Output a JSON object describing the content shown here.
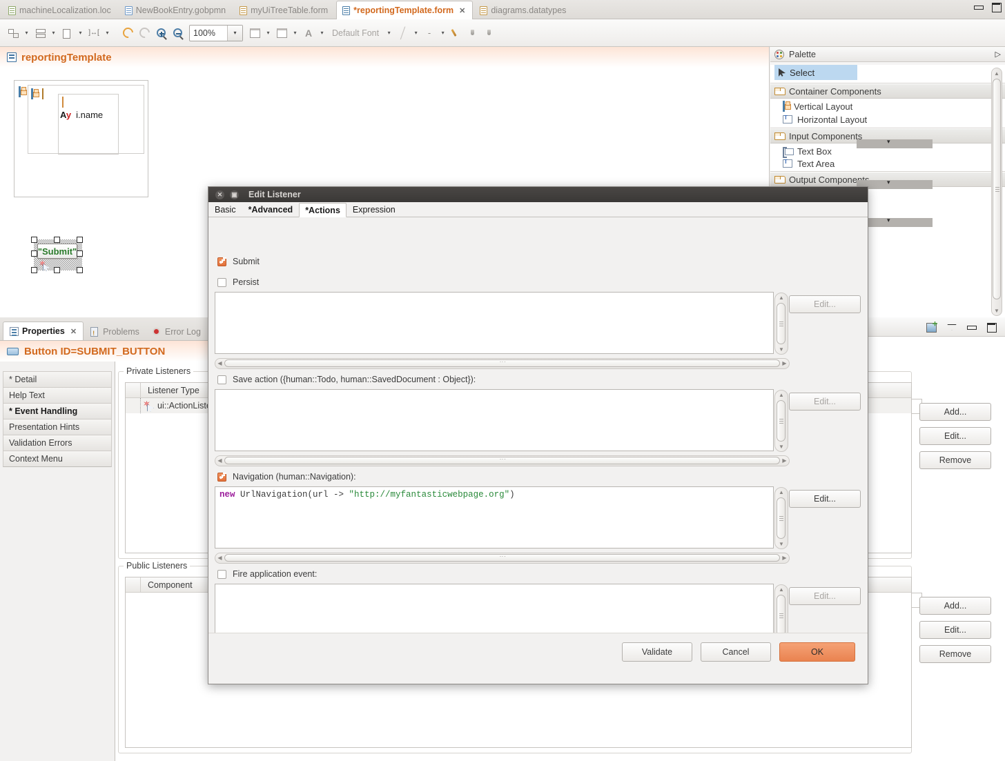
{
  "window": {
    "minimize_label": "minimize",
    "maximize_label": "maximize"
  },
  "editor_tabs": [
    {
      "label": "machineLocalization.loc",
      "icon": "file-loc-icon",
      "active": false
    },
    {
      "label": "NewBookEntry.gobpmn",
      "icon": "file-bpmn-icon",
      "active": false
    },
    {
      "label": "myUiTreeTable.form",
      "icon": "file-form-icon",
      "active": false
    },
    {
      "label": "*reportingTemplate.form",
      "icon": "file-form-icon",
      "active": true,
      "close": "✕"
    },
    {
      "label": "diagrams.datatypes",
      "icon": "file-datatypes-icon",
      "active": false
    }
  ],
  "toolbar": {
    "zoom_value": "100%",
    "font_label": "Default Font",
    "letter_glyph": "A",
    "dash_glyph": "-",
    "caret": "▾"
  },
  "editor": {
    "form_title": "reportingTemplate",
    "column_label_prefix": "Ay",
    "column_label": "i.name",
    "submit_button_label": "\"Submit\""
  },
  "palette": {
    "title": "Palette",
    "expand_glyph": "▷",
    "select_label": "Select",
    "groups": [
      {
        "label": "Container Components",
        "items": [
          "Vertical Layout",
          "Horizontal Layout"
        ]
      },
      {
        "label": "Input Components",
        "items": [
          "Text Box",
          "Text Area"
        ]
      },
      {
        "label": "Output Components",
        "items": []
      }
    ],
    "collapse_glyph": "«»"
  },
  "properties": {
    "tabs": [
      {
        "label": "Properties",
        "active": true,
        "close": "✕",
        "icon": "properties-icon"
      },
      {
        "label": "Problems",
        "active": false,
        "icon": "problems-icon"
      },
      {
        "label": "Error Log",
        "active": false,
        "icon": "error-log-icon"
      }
    ],
    "header": "Button ID=SUBMIT_BUTTON",
    "nav_items": [
      {
        "label": "* Detail",
        "selected": false
      },
      {
        "label": "Help Text",
        "selected": false
      },
      {
        "label": "* Event Handling",
        "selected": true
      },
      {
        "label": "Presentation Hints",
        "selected": false
      },
      {
        "label": "Validation Errors",
        "selected": false
      },
      {
        "label": "Context Menu",
        "selected": false
      }
    ],
    "private_listeners": {
      "group_label": "Private Listeners",
      "column_header": "Listener Type",
      "rows": [
        {
          "type": "ui::ActionListener",
          "icon": "listener-icon"
        }
      ]
    },
    "public_listeners": {
      "group_label": "Public Listeners",
      "column_header": "Component",
      "rows": []
    }
  },
  "right_panel": {
    "buttons_group_1": [
      "Add...",
      "Edit...",
      "Remove"
    ],
    "buttons_group_2": [
      "Add...",
      "Edit...",
      "Remove"
    ],
    "toolbar_icons": [
      "new-view-icon",
      "view-menu-icon",
      "minimize-icon",
      "maximize-icon"
    ]
  },
  "dialog": {
    "title": "Edit Listener",
    "close_glyph": "✕",
    "restore_glyph": "▣",
    "tabs": [
      {
        "label": "Basic",
        "active": false,
        "modified": false
      },
      {
        "label": "*Advanced",
        "active": false,
        "modified": true
      },
      {
        "label": "*Actions",
        "active": true,
        "modified": true
      },
      {
        "label": "Expression",
        "active": false,
        "modified": false
      }
    ],
    "submit": {
      "label": "Submit",
      "checked": true
    },
    "persist": {
      "label": "Persist",
      "checked": false
    },
    "submit_editor": {
      "value": "",
      "edit_label": "Edit...",
      "edit_enabled": false
    },
    "save_action": {
      "label": "Save action ({human::Todo, human::SavedDocument : Object}):",
      "checked": false,
      "value": "",
      "edit_label": "Edit...",
      "edit_enabled": false
    },
    "navigation": {
      "label": "Navigation (human::Navigation):",
      "checked": true,
      "code_keyword": "new",
      "code_body": " UrlNavigation(url -> ",
      "code_string": "\"http://myfantasticwebpage.org\"",
      "code_tail": ")",
      "edit_label": "Edit...",
      "edit_enabled": true
    },
    "fire_event": {
      "label": "Fire application event:",
      "checked": false,
      "value": "",
      "edit_label": "Edit...",
      "edit_enabled": false
    },
    "footer": {
      "validate_label": "Validate",
      "cancel_label": "Cancel",
      "ok_label": "OK",
      "ok_color": "#ea8350"
    }
  },
  "colors": {
    "accent_orange": "#d2691e",
    "selection_blue": "#bcd8f0",
    "keyword_purple": "#9b1c9b",
    "string_green": "#2a8a3a",
    "button_text_green": "#2a7a2a",
    "titlebar_dark": "#3a3836"
  }
}
